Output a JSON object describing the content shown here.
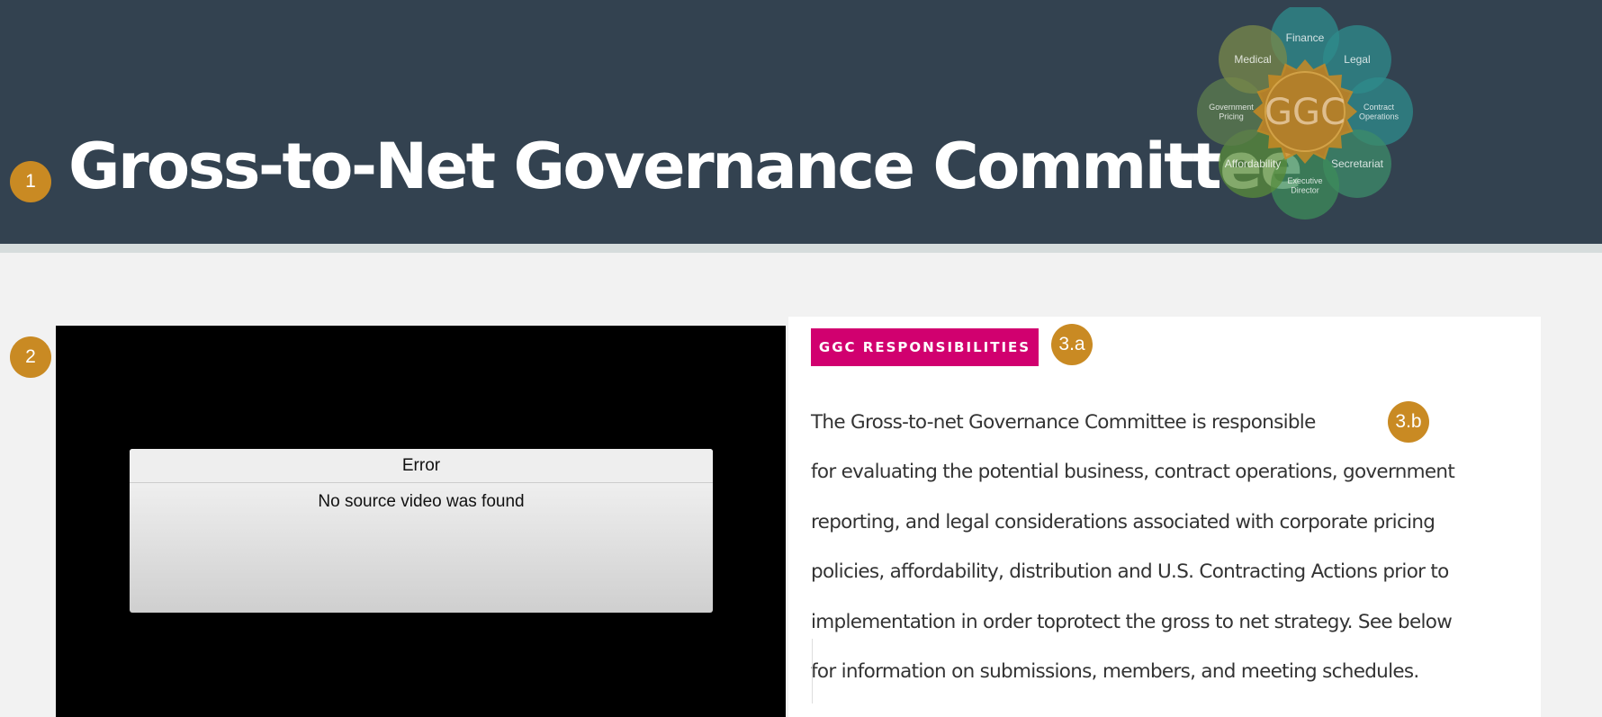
{
  "header": {
    "title": "Gross-to-Net Governance Committee",
    "background_color": "#334250"
  },
  "logo": {
    "center_label": "GGC",
    "petals": [
      {
        "lines": [
          "Finance"
        ],
        "color": "#2f8c8c"
      },
      {
        "lines": [
          "Legal"
        ],
        "color": "#2f8c8c"
      },
      {
        "lines": [
          "Contract",
          "Operations"
        ],
        "color": "#2f8c8c"
      },
      {
        "lines": [
          "Secretariat"
        ],
        "color": "#3e8c6a"
      },
      {
        "lines": [
          "Executive",
          "Director"
        ],
        "color": "#3e8c5a"
      },
      {
        "lines": [
          "Affordability"
        ],
        "color": "#5a8c3a"
      },
      {
        "lines": [
          "Government",
          "Pricing"
        ],
        "color": "#5e7e4e"
      },
      {
        "lines": [
          "Medical"
        ],
        "color": "#7a8a4a"
      }
    ],
    "center_color": "#c98a23"
  },
  "callouts": {
    "c1": "1",
    "c2": "2",
    "c3a": "3.a",
    "c3b": "3.b",
    "color": "#c98a23"
  },
  "video": {
    "error_title": "Error",
    "error_message": "No source video was found"
  },
  "responsibilities": {
    "tag_label": "GGC RESPONSIBILITIES",
    "tag_color": "#d1006f",
    "lines": [
      "The Gross-to-net Governance Committee is responsible",
      "for evaluating the potential business, contract operations, government",
      "reporting, and legal considerations associated with corporate pricing",
      "policies, affordability, distribution and U.S. Contracting Actions prior to",
      "implementation in order toprotect the gross to net strategy.  See below",
      "for information on submissions, members, and meeting schedules."
    ]
  }
}
